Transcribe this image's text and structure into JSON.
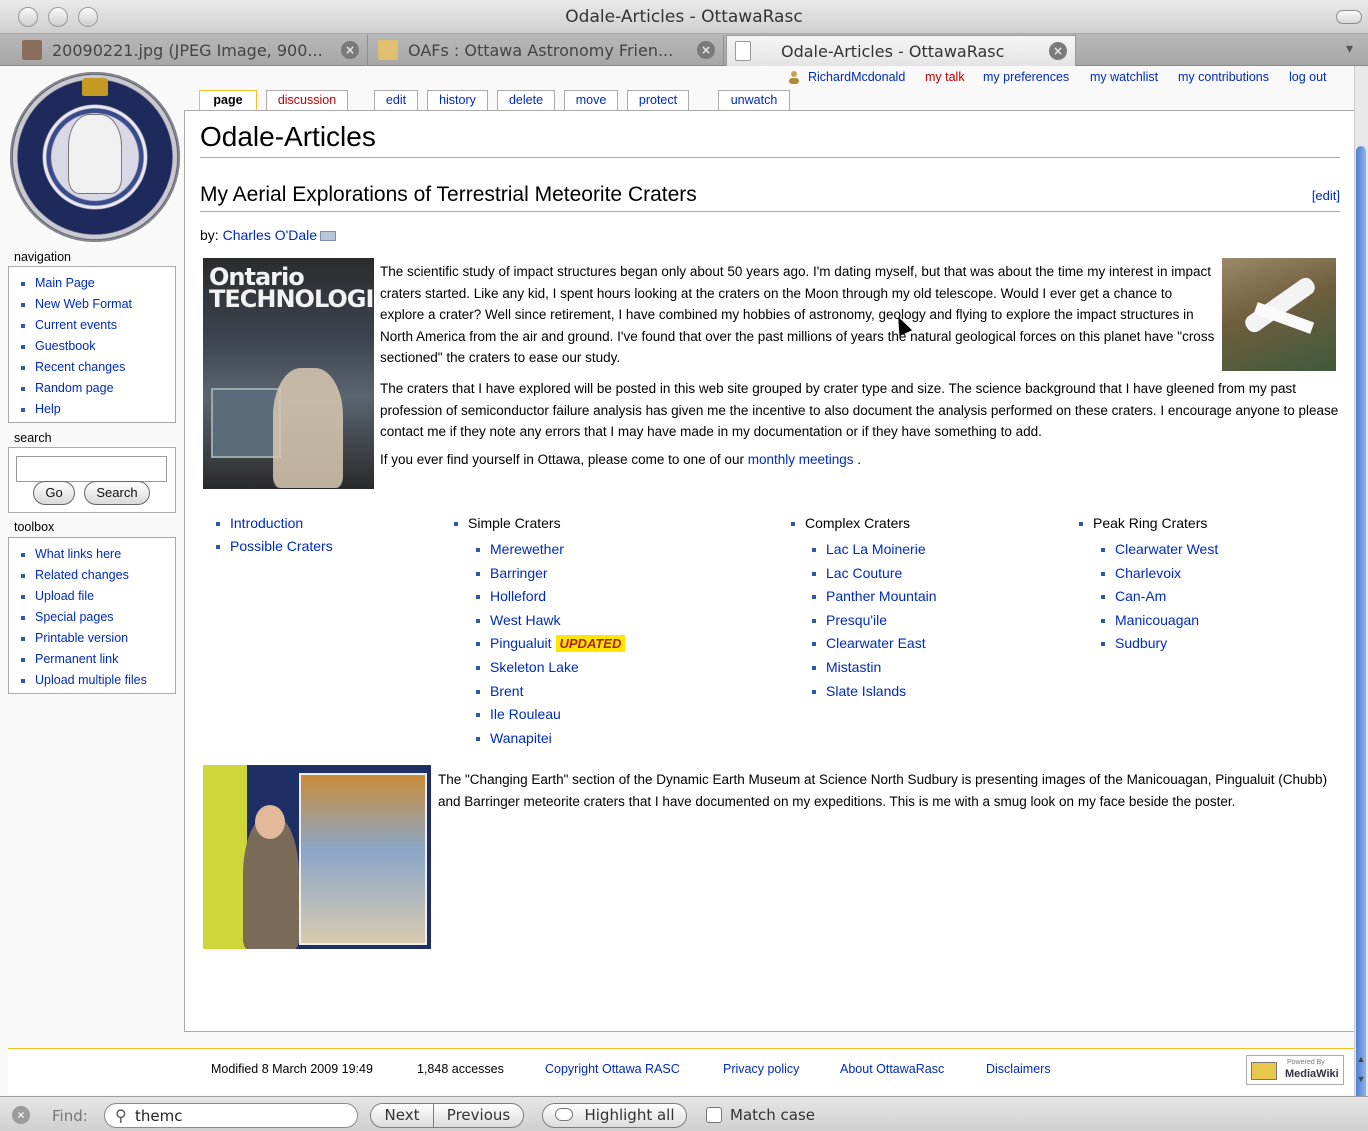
{
  "window": {
    "title": "Odale-Articles - OttawaRasc"
  },
  "browser_tabs": [
    {
      "label": "20090221.jpg (JPEG Image, 900...",
      "icon": "image-file-icon"
    },
    {
      "label": "OAFs : Ottawa Astronomy Frien...",
      "icon": "site-favicon-icon"
    },
    {
      "label": "Odale-Articles - OttawaRasc",
      "icon": "blank-page-icon",
      "active": true
    }
  ],
  "personal": {
    "user": "RichardMcdonald",
    "talk": "my talk",
    "preferences": "my preferences",
    "watchlist": "my watchlist",
    "contributions": "my contributions",
    "logout": "log out"
  },
  "content_tabs": {
    "page": "page",
    "discussion": "discussion",
    "edit": "edit",
    "history": "history",
    "delete": "delete",
    "move": "move",
    "protect": "protect",
    "unwatch": "unwatch"
  },
  "sidebar": {
    "navigation_title": "navigation",
    "navigation": [
      "Main Page",
      "New Web Format",
      "Current events",
      "Guestbook",
      "Recent changes",
      "Random page",
      "Help"
    ],
    "search_title": "search",
    "search_value": "",
    "go_label": "Go",
    "search_label": "Search",
    "toolbox_title": "toolbox",
    "toolbox": [
      "What links here",
      "Related changes",
      "Upload file",
      "Special pages",
      "Printable version",
      "Permanent link",
      "Upload multiple files"
    ]
  },
  "article": {
    "title": "Odale-Articles",
    "section_title": "My Aerial Explorations of Terrestrial Meteorite Craters",
    "edit_section": "[edit]",
    "by_prefix": "by: ",
    "author": "Charles O'Dale",
    "magazine_title_line1": "Ontario",
    "magazine_title_line2": "TECHNOLOGIST",
    "p1": "The scientific study of impact structures began only about 50 years ago. I'm dating myself, but that was about the time my interest in impact craters started. Like any kid, I spent hours looking at the craters on the Moon through my old telescope. Would I ever get a chance to explore a crater? Well since retirement, I have combined my hobbies of astronomy, geology and flying to explore the impact structures in North America from the air and ground. I've found that over the past millions of years the natural geological forces on this planet have \"cross sectioned\" the craters to ease our study.",
    "p2": "The craters that I have explored will be posted in this web site grouped by crater type and size. The science background that I have gleened from my past profession of semiconductor failure analysis has given me the incentive to also document the analysis performed on these craters. I encourage anyone to please contact me if they note any errors that I may have made in my documentation or if they have something to add.",
    "p3_before": "If you ever find yourself in Ottawa, please come to one of our ",
    "p3_link": "monthly meetings",
    "p3_after": " .",
    "col1": [
      "Introduction",
      "Possible Craters"
    ],
    "col2_head": "Simple Craters",
    "col2": [
      "Merewether",
      "Barringer",
      "Holleford",
      "West Hawk",
      "Pingualuit",
      "Skeleton Lake",
      "Brent",
      "Ile Rouleau",
      "Wanapitei"
    ],
    "updated_badge": "UPDATED",
    "col3_head": "Complex Craters",
    "col3": [
      "Lac La Moinerie",
      "Lac Couture",
      "Panther Mountain",
      "Presqu'ile",
      "Clearwater East",
      "Mistastin",
      "Slate Islands"
    ],
    "col4_head": "Peak Ring Craters",
    "col4": [
      "Clearwater West",
      "Charlevoix",
      "Can-Am",
      "Manicouagan",
      "Sudbury"
    ],
    "p4": "The \"Changing Earth\" section of the Dynamic Earth Museum at Science North Sudbury is presenting images of the Manicouagan, Pingualuit (Chubb) and Barringer meteorite craters that I have documented on my expeditions. This is me with a smug look on my face beside the poster."
  },
  "footer": {
    "modified": "Modified 8 March 2009 19:49",
    "accesses": "1,848 accesses",
    "copyright": "Copyright Ottawa RASC",
    "privacy": "Privacy policy",
    "about": "About OttawaRasc",
    "disclaimers": "Disclaimers",
    "powered_small": "Powered By",
    "powered_name": "MediaWiki"
  },
  "findbar": {
    "label": "Find:",
    "value": "themc",
    "next": "Next",
    "previous": "Previous",
    "highlight": "Highlight all",
    "match_case": "Match case"
  },
  "colors": {
    "link": "#002bb8",
    "new_link": "#ba0000",
    "tab_accent": "#fabd23",
    "badge": "#ffe600"
  }
}
